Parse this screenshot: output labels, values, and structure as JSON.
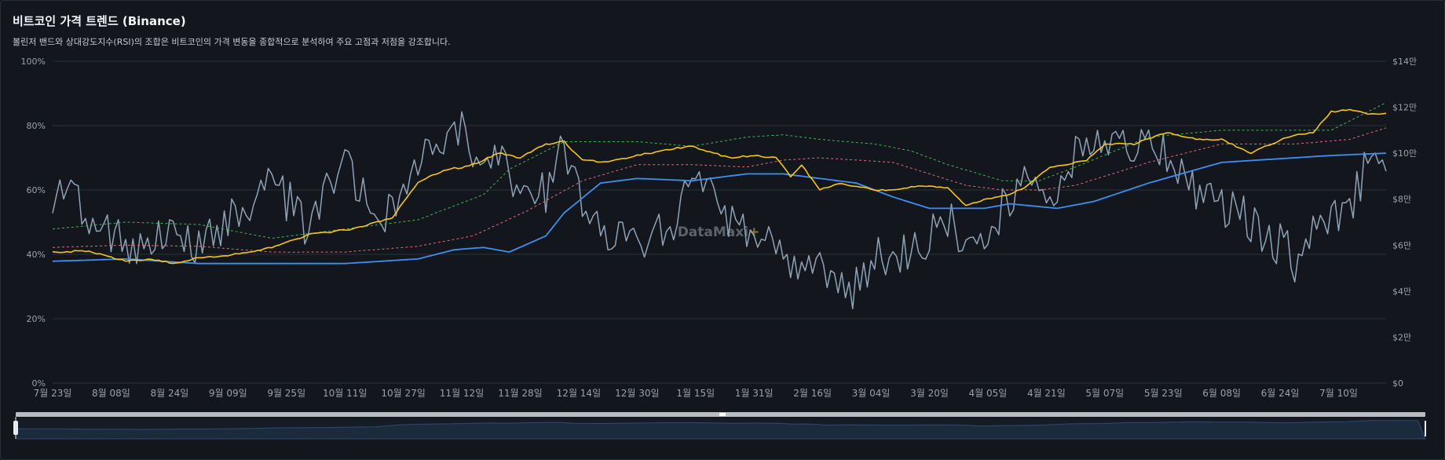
{
  "header": {
    "title": "비트코인 가격 트렌드 (Binance)",
    "subtitle": "볼린저 밴드와 상대강도지수(RSI)의 조합은 비트코인의 가격 변동을 종합적으로 분석하여 주요 고점과 저점을 강조합니다."
  },
  "watermark": {
    "text": "DataMaxi",
    "plus": "+"
  },
  "colors": {
    "background": "#13171d",
    "grid": "#2b3038",
    "axis_text": "#9aa1ab",
    "price": "#f5c518",
    "sma": "#3d8ff0",
    "upper_band": "#3fb950",
    "lower_band": "#e06c75",
    "rsi": "#8fa3b8"
  },
  "chart_data": {
    "type": "line",
    "title": "비트코인 가격 트렌드 (Binance)",
    "x_tick_labels": [
      "7월 23일",
      "8월 08일",
      "8월 24일",
      "9월 09일",
      "9월 25일",
      "10월 11일",
      "10월 27일",
      "11월 12일",
      "11월 28일",
      "12월 14일",
      "12월 30일",
      "1월 15일",
      "1월 31일",
      "2월 16일",
      "3월 04일",
      "3월 20일",
      "4월 05일",
      "4월 21일",
      "5월 07일",
      "5월 23일",
      "6월 08일",
      "6월 24일",
      "7월 10일"
    ],
    "x_start": "7월 23일",
    "x_interval_days": 16,
    "x_end_days": 365,
    "left_axis": {
      "ticks": [
        "0%",
        "20%",
        "40%",
        "60%",
        "80%",
        "100%"
      ],
      "range": [
        0,
        100
      ]
    },
    "right_axis": {
      "ticks": [
        "$0",
        "$2만",
        "$4만",
        "$6만",
        "$8만",
        "$10만",
        "$12만",
        "$14만"
      ],
      "range": [
        0,
        140000
      ]
    },
    "grid": true,
    "series": [
      {
        "axis": "right",
        "keypoints_days": [
          0,
          10,
          15,
          20,
          27,
          33,
          40,
          50,
          55,
          62,
          70,
          75,
          82,
          93,
          100,
          108,
          113,
          118,
          122,
          128,
          135,
          140,
          145,
          152,
          160,
          170,
          175,
          185,
          192,
          198,
          202,
          205,
          210,
          215,
          225,
          230,
          238,
          245,
          250,
          255,
          262,
          266,
          273,
          278,
          283,
          288,
          296,
          305,
          313,
          320,
          328,
          335,
          340,
          345,
          350,
          355,
          360,
          365
        ],
        "values": [
          57000,
          57500,
          55000,
          53000,
          54000,
          52000,
          54500,
          56000,
          57000,
          60000,
          64500,
          65500,
          67000,
          72000,
          87500,
          93000,
          94000,
          97000,
          100000,
          98000,
          104000,
          105000,
          97000,
          96000,
          99000,
          102000,
          103000,
          98000,
          99000,
          98000,
          90000,
          95000,
          84000,
          87000,
          84000,
          84000,
          86000,
          85000,
          77000,
          80000,
          82000,
          85000,
          94000,
          95000,
          97000,
          104000,
          104000,
          109000,
          106000,
          106000,
          100000,
          105000,
          108000,
          109000,
          118000,
          119000,
          117000,
          117000
        ]
      },
      {
        "axis": "right",
        "keypoints_days": [
          0,
          20,
          40,
          60,
          80,
          100,
          115,
          130,
          145,
          160,
          175,
          190,
          200,
          210,
          220,
          230,
          240,
          250,
          260,
          270,
          280,
          300,
          320,
          340,
          355,
          365
        ],
        "values": [
          59000,
          60000,
          59500,
          57000,
          57000,
          59500,
          64000,
          75000,
          88000,
          95000,
          95000,
          94000,
          97000,
          98000,
          97000,
          96000,
          91000,
          86000,
          84000,
          84000,
          86000,
          96000,
          104000,
          104000,
          106000,
          111000
        ]
      },
      {
        "axis": "right",
        "keypoints_days": [
          0,
          20,
          40,
          60,
          80,
          100,
          118,
          125,
          140,
          145,
          160,
          175,
          190,
          200,
          210,
          225,
          235,
          245,
          260,
          270,
          280,
          300,
          320,
          340,
          350,
          365
        ],
        "values": [
          67000,
          70000,
          69000,
          63000,
          67000,
          71000,
          82000,
          93000,
          105000,
          105000,
          105000,
          103000,
          107000,
          108000,
          106000,
          104000,
          101000,
          95000,
          88000,
          88000,
          94000,
          107000,
          110000,
          110000,
          110000,
          122000
        ]
      },
      {
        "axis": "right",
        "keypoints_days": [
          0,
          20,
          40,
          60,
          80,
          100,
          110,
          118,
          125,
          135,
          140,
          150,
          160,
          175,
          190,
          200,
          210,
          220,
          230,
          240,
          255,
          262,
          275,
          285,
          300,
          320,
          340,
          350,
          365
        ],
        "values": [
          53000,
          54000,
          52000,
          52000,
          52000,
          54000,
          58000,
          59000,
          57000,
          64000,
          74000,
          87000,
          89000,
          88000,
          91000,
          91000,
          89000,
          87000,
          81000,
          76000,
          76000,
          78000,
          76000,
          79000,
          87000,
          96000,
          98000,
          99000,
          100000
        ]
      },
      {
        "axis": "left",
        "keypoints_days": [
          0,
          5,
          10,
          15,
          20,
          25,
          30,
          35,
          40,
          45,
          50,
          55,
          60,
          65,
          70,
          75,
          80,
          85,
          90,
          95,
          100,
          103,
          105,
          108,
          112,
          115,
          120,
          125,
          130,
          135,
          140,
          145,
          150,
          155,
          160,
          165,
          170,
          175,
          180,
          185,
          190,
          195,
          200,
          205,
          210,
          215,
          218,
          220,
          225,
          230,
          235,
          240,
          245,
          250,
          255,
          260,
          265,
          270,
          275,
          280,
          285,
          290,
          292,
          295,
          300,
          305,
          310,
          315,
          320,
          325,
          330,
          335,
          340,
          345,
          350,
          355,
          360,
          365
        ],
        "values": [
          58,
          60,
          50,
          46,
          44,
          42,
          48,
          45,
          42,
          48,
          52,
          58,
          62,
          56,
          46,
          62,
          68,
          58,
          52,
          60,
          70,
          78,
          75,
          72,
          78,
          70,
          72,
          66,
          60,
          60,
          74,
          54,
          48,
          47,
          46,
          45,
          50,
          64,
          58,
          52,
          48,
          44,
          36,
          40,
          37,
          31,
          28,
          32,
          40,
          36,
          42,
          45,
          52,
          44,
          48,
          54,
          63,
          56,
          62,
          72,
          76,
          78,
          80,
          72,
          75,
          70,
          62,
          60,
          54,
          52,
          48,
          44,
          38,
          48,
          52,
          55,
          68,
          71
        ]
      }
    ]
  }
}
